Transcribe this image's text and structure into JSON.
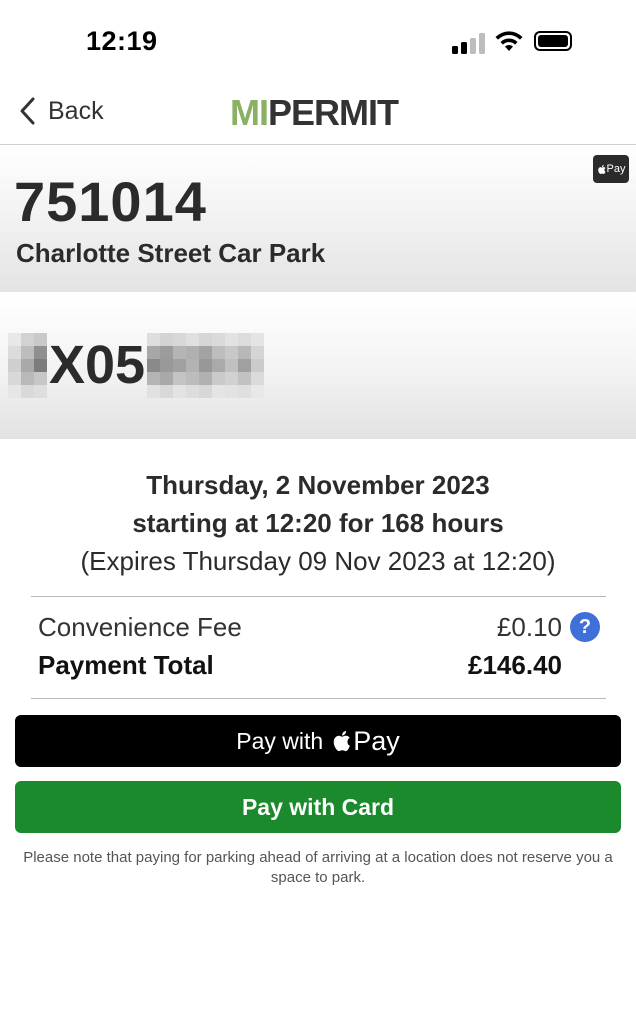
{
  "status_bar": {
    "time": "12:19",
    "signal_icon": "cellular-signal-icon",
    "wifi_icon": "wifi-icon",
    "battery_icon": "battery-icon"
  },
  "nav": {
    "back_label": "Back",
    "back_icon": "chevron-left-icon",
    "logo_mi": "MI",
    "logo_permit": "PERMIT",
    "logo_colors": {
      "mi": "#8ab063",
      "permit": "#333333"
    }
  },
  "location": {
    "code": "751014",
    "name": "Charlotte Street Car Park",
    "badge_label": "Pay"
  },
  "vehicle": {
    "registration_visible": "X05",
    "note_pixelated": true
  },
  "booking": {
    "date": "Thursday, 2 November 2023",
    "start": "starting at 12:20 for 168 hours",
    "expiry": "(Expires Thursday 09 Nov 2023 at 12:20)"
  },
  "fees": {
    "convenience_label": "Convenience Fee",
    "convenience_value": "£0.10",
    "help_icon": "question-mark-icon",
    "help_symbol": "?",
    "total_label": "Payment Total",
    "total_value": "£146.40"
  },
  "actions": {
    "applepay_prefix": "Pay with",
    "applepay_brand": "Pay",
    "card_label": "Pay with Card",
    "colors": {
      "applepay_bg": "#000000",
      "card_bg": "#1a8a2c"
    }
  },
  "notice": "Please note that paying for parking ahead of arriving at a location does not reserve you a space to park."
}
